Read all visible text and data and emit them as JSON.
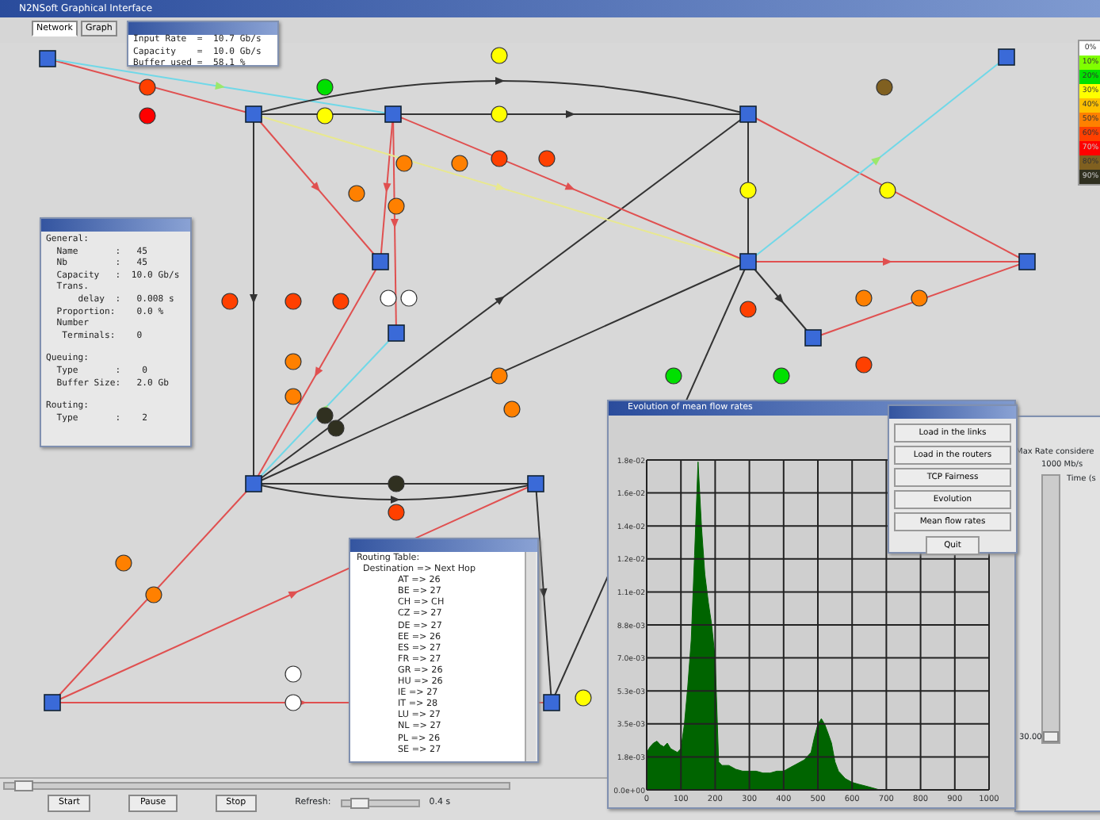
{
  "window": {
    "title": "N2NSoft Graphical Interface"
  },
  "tabs": [
    {
      "label": "Network",
      "selected": true
    },
    {
      "label": "Graph",
      "selected": false
    }
  ],
  "link_popup": {
    "lines": [
      "Input Rate  =  10.7 Gb/s",
      "Capacity    =  10.0 Gb/s",
      "Buffer used =  58.1 %"
    ]
  },
  "node_properties": {
    "sections": [
      {
        "heading": "General:",
        "lines": [
          "  Name       :   45",
          "  Nb         :   45",
          "  Capacity   :  10.0 Gb/s",
          "  Trans.",
          "      delay  :   0.008 s",
          "  Proportion:    0.0 %",
          "  Number",
          "   Terminals:    0"
        ]
      },
      {
        "heading": "Queuing:",
        "lines": [
          "  Type       :    0",
          "  Buffer Size:   2.0 Gb"
        ]
      },
      {
        "heading": "Routing:",
        "lines": [
          "  Type       :    2"
        ]
      }
    ]
  },
  "routing_table": {
    "heading": "Routing Table:",
    "columns_header": "Destination =>  Next Hop",
    "rows": [
      "AT => 26",
      "BE => 27",
      "CH => CH",
      "CZ => 27",
      "DE => 27",
      "EE => 26",
      "ES => 27",
      "FR => 27",
      "GR => 26",
      "HU => 26",
      "IE => 27",
      "IT => 28",
      "LU => 27",
      "NL => 27",
      "PL => 26",
      "SE => 27"
    ]
  },
  "legend": [
    {
      "label": "0%",
      "color": "#ffffff"
    },
    {
      "label": "10%",
      "color": "#80ff00"
    },
    {
      "label": "20%",
      "color": "#00e000"
    },
    {
      "label": "30%",
      "color": "#ffff00"
    },
    {
      "label": "40%",
      "color": "#ffc000"
    },
    {
      "label": "50%",
      "color": "#ff8000"
    },
    {
      "label": "60%",
      "color": "#ff4000"
    },
    {
      "label": "70%",
      "color": "#ff0000"
    },
    {
      "label": "80%",
      "color": "#806020"
    },
    {
      "label": "90%",
      "color": "#303020"
    }
  ],
  "chart_window": {
    "title": "Evolution of mean flow rates",
    "chart_data": {
      "type": "area",
      "xlim": [
        0,
        1000
      ],
      "ylim": [
        0,
        0.0176
      ],
      "xticks": [
        0,
        100,
        200,
        300,
        400,
        500,
        600,
        700,
        800,
        900,
        1000
      ],
      "yticks": [
        {
          "value": 0,
          "label": "0.0e+00"
        },
        {
          "value": 0.00176,
          "label": "1.8e-03"
        },
        {
          "value": 0.00352,
          "label": "3.5e-03"
        },
        {
          "value": 0.00528,
          "label": "5.3e-03"
        },
        {
          "value": 0.00704,
          "label": "7.0e-03"
        },
        {
          "value": 0.0088,
          "label": "8.8e-03"
        },
        {
          "value": 0.01056,
          "label": "1.1e-02"
        },
        {
          "value": 0.01232,
          "label": "1.2e-02"
        },
        {
          "value": 0.01408,
          "label": "1.4e-02"
        },
        {
          "value": 0.01584,
          "label": "1.6e-02"
        },
        {
          "value": 0.0176,
          "label": "1.8e-02"
        }
      ],
      "x": [
        0,
        10,
        20,
        30,
        40,
        50,
        60,
        70,
        80,
        90,
        100,
        110,
        120,
        130,
        140,
        150,
        160,
        170,
        180,
        190,
        200,
        210,
        220,
        240,
        260,
        280,
        300,
        320,
        340,
        360,
        380,
        400,
        420,
        440,
        460,
        480,
        490,
        500,
        510,
        520,
        530,
        540,
        550,
        560,
        580,
        600,
        620,
        640,
        660,
        680,
        700,
        720,
        800
      ],
      "series": [
        {
          "color": "#006400",
          "values": [
            0.002,
            0.0023,
            0.0025,
            0.0026,
            0.0024,
            0.0023,
            0.0025,
            0.0022,
            0.0021,
            0.002,
            0.0022,
            0.0035,
            0.0055,
            0.008,
            0.0125,
            0.0175,
            0.014,
            0.0115,
            0.01,
            0.0088,
            0.007,
            0.0015,
            0.0013,
            0.0013,
            0.0011,
            0.001,
            0.001,
            0.001,
            0.0009,
            0.0009,
            0.001,
            0.001,
            0.0012,
            0.0014,
            0.0016,
            0.002,
            0.0028,
            0.0035,
            0.0038,
            0.0035,
            0.003,
            0.0025,
            0.0015,
            0.001,
            0.0006,
            0.0004,
            0.0003,
            0.0002,
            0.0001,
            0,
            0,
            0,
            0
          ]
        }
      ],
      "grid": true
    }
  },
  "menu_buttons": [
    "Load in the links",
    "Load in the routers",
    "TCP Fairness",
    "Evolution",
    "Mean flow rates",
    "Quit"
  ],
  "rate_panel": {
    "label": "Max Rate considere",
    "rate": "1000 Mb/s",
    "time_label": "Time (s",
    "value": "30.00",
    "level": 0
  },
  "controls": {
    "position_slider": {
      "level": 0.02
    },
    "buttons": [
      "Start",
      "Pause",
      "Stop"
    ],
    "refresh_label": "Refresh:",
    "refresh_slider": {
      "level": 0.15
    },
    "refresh_value": "0.4 s"
  }
}
